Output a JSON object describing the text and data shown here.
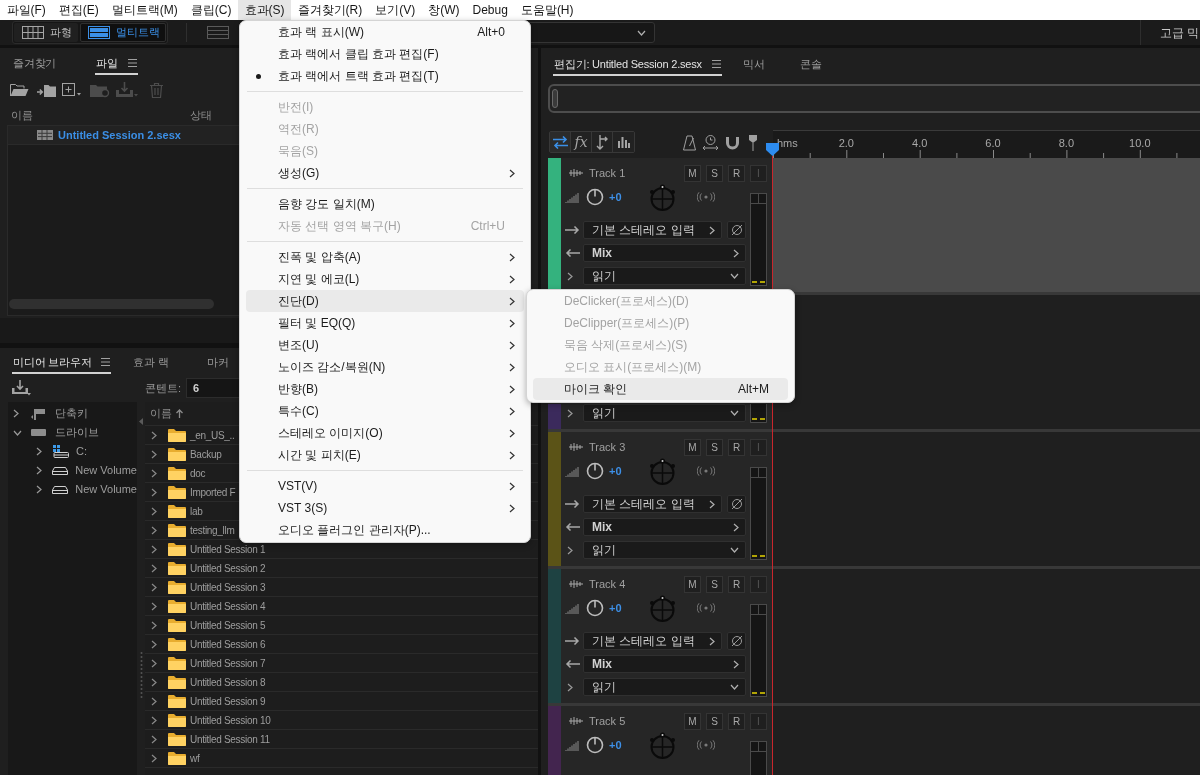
{
  "menu_bar": [
    {
      "label": "파일(F)",
      "selected": false
    },
    {
      "label": "편집(E)",
      "selected": false
    },
    {
      "label": "멀티트랙(M)",
      "selected": false
    },
    {
      "label": "클립(C)",
      "selected": false
    },
    {
      "label": "효과(S)",
      "selected": true
    },
    {
      "label": "즐겨찾기(R)",
      "selected": false
    },
    {
      "label": "보기(V)",
      "selected": false
    },
    {
      "label": "창(W)",
      "selected": false
    },
    {
      "label": "Debug",
      "selected": false
    },
    {
      "label": "도움말(H)",
      "selected": false
    }
  ],
  "toolbar": {
    "modes": [
      {
        "kind": "waveform",
        "label": "파형",
        "selected": false
      },
      {
        "kind": "multitrack",
        "label": "멀티트랙",
        "selected": true
      }
    ],
    "workspace": "고급 믹"
  },
  "files_panel": {
    "tabs": [
      {
        "label": "즐겨찾기",
        "selected": false
      },
      {
        "label": "파일",
        "selected": true
      }
    ],
    "columns": [
      "이름",
      "상태"
    ],
    "rows": [
      {
        "name": "Untitled Session 2.sesx"
      }
    ]
  },
  "media_browser": {
    "tabs": [
      {
        "label": "미디어 브라우저",
        "selected": true
      },
      {
        "label": "효과 랙",
        "selected": false
      },
      {
        "label": "마커",
        "selected": false
      }
    ],
    "content_label": "콘텐트:",
    "content_value": "6",
    "tree": [
      {
        "kind": "shortcuts",
        "label": "단축키",
        "expanded": false
      },
      {
        "kind": "drives",
        "label": "드라이브",
        "expanded": true,
        "children": [
          {
            "kind": "system-drive",
            "label": "C:",
            "expanded": false
          },
          {
            "kind": "drive",
            "label": "New Volume",
            "expanded": false
          },
          {
            "kind": "drive",
            "label": "New Volume",
            "expanded": false
          }
        ]
      }
    ],
    "list_header": "이름",
    "items": [
      {
        "kind": "folder",
        "name": "_en_US_.."
      },
      {
        "kind": "folder",
        "name": "Backup"
      },
      {
        "kind": "folder",
        "name": "doc"
      },
      {
        "kind": "folder",
        "name": "Imported F"
      },
      {
        "kind": "folder",
        "name": "lab"
      },
      {
        "kind": "folder",
        "name": "testing_llm"
      },
      {
        "kind": "folder",
        "name": "Untitled Session 1"
      },
      {
        "kind": "folder",
        "name": "Untitled Session 2"
      },
      {
        "kind": "folder",
        "name": "Untitled Session 3"
      },
      {
        "kind": "folder",
        "name": "Untitled Session 4"
      },
      {
        "kind": "folder",
        "name": "Untitled Session 5"
      },
      {
        "kind": "folder",
        "name": "Untitled Session 6"
      },
      {
        "kind": "folder",
        "name": "Untitled Session 7"
      },
      {
        "kind": "folder",
        "name": "Untitled Session 8"
      },
      {
        "kind": "folder",
        "name": "Untitled Session 9"
      },
      {
        "kind": "folder",
        "name": "Untitled Session 10"
      },
      {
        "kind": "folder",
        "name": "Untitled Session 11"
      },
      {
        "kind": "folder",
        "name": "wf"
      }
    ]
  },
  "editor": {
    "tabs": [
      {
        "label": "편집기: Untitled Session 2.sesx",
        "selected": true
      },
      {
        "label": "믹서",
        "selected": false
      },
      {
        "label": "콘솔",
        "selected": false
      }
    ],
    "view_buttons": [
      {
        "kind": "inputs-outputs",
        "selected": true
      },
      {
        "kind": "effects",
        "label": "fx",
        "selected": false
      },
      {
        "kind": "sends",
        "selected": false
      },
      {
        "kind": "eq",
        "selected": false
      }
    ],
    "ruler": [
      "hms",
      "2.0",
      "4.0",
      "6.0",
      "8.0",
      "10.0"
    ],
    "tracks": [
      {
        "name": "Track 1",
        "color": "#34b27e",
        "selected": true,
        "buttons": [
          {
            "label": "M",
            "disabled": false
          },
          {
            "label": "S",
            "disabled": false
          },
          {
            "label": "R",
            "disabled": false
          },
          {
            "label": "I",
            "disabled": true
          }
        ],
        "volume": "+0",
        "input": "기본 스테레오 입력",
        "output": "Mix",
        "automation": "읽기"
      },
      {
        "color": "#3b2a5c",
        "selected": false,
        "automation": "읽기"
      },
      {
        "name": "Track 3",
        "color": "#5b5317",
        "selected": false,
        "buttons": [
          {
            "label": "M",
            "disabled": false
          },
          {
            "label": "S",
            "disabled": false
          },
          {
            "label": "R",
            "disabled": false
          },
          {
            "label": "I",
            "disabled": true
          }
        ],
        "volume": "+0",
        "input": "기본 스테레오 입력",
        "output": "Mix",
        "automation": "읽기"
      },
      {
        "name": "Track 4",
        "color": "#1e4242",
        "selected": false,
        "buttons": [
          {
            "label": "M",
            "disabled": false
          },
          {
            "label": "S",
            "disabled": false
          },
          {
            "label": "R",
            "disabled": false
          },
          {
            "label": "I",
            "disabled": true
          }
        ],
        "volume": "+0",
        "input": "기본 스테레오 입력",
        "output": "Mix",
        "automation": "읽기"
      },
      {
        "name": "Track 5",
        "color": "#43254f",
        "selected": false,
        "buttons": [
          {
            "label": "M",
            "disabled": false
          },
          {
            "label": "S",
            "disabled": false
          },
          {
            "label": "R",
            "disabled": false
          },
          {
            "label": "I",
            "disabled": true
          }
        ],
        "volume": "+0"
      }
    ]
  },
  "effects_menu": {
    "items": [
      {
        "kind": "item",
        "label": "효과 랙 표시(W)",
        "shortcut": "Alt+0",
        "checked": false,
        "disabled": false,
        "submenu": false,
        "highlighted": false
      },
      {
        "kind": "item",
        "label": "효과 랙에서 클립 효과 편집(F)",
        "checked": false,
        "disabled": false,
        "submenu": false,
        "highlighted": false
      },
      {
        "kind": "item",
        "label": "효과 랙에서 트랙 효과 편집(T)",
        "checked": true,
        "disabled": false,
        "submenu": false,
        "highlighted": false
      },
      {
        "kind": "separator"
      },
      {
        "kind": "item",
        "label": "반전(I)",
        "checked": false,
        "disabled": true,
        "submenu": false,
        "highlighted": false
      },
      {
        "kind": "item",
        "label": "역전(R)",
        "checked": false,
        "disabled": true,
        "submenu": false,
        "highlighted": false
      },
      {
        "kind": "item",
        "label": "묵음(S)",
        "checked": false,
        "disabled": true,
        "submenu": false,
        "highlighted": false
      },
      {
        "kind": "item",
        "label": "생성(G)",
        "checked": false,
        "disabled": false,
        "submenu": true,
        "highlighted": false
      },
      {
        "kind": "separator"
      },
      {
        "kind": "item",
        "label": "음향 강도 일치(M)",
        "checked": false,
        "disabled": false,
        "submenu": false,
        "highlighted": false
      },
      {
        "kind": "item",
        "label": "자동 선택 영역 복구(H)",
        "shortcut": "Ctrl+U",
        "checked": false,
        "disabled": true,
        "submenu": false,
        "highlighted": false
      },
      {
        "kind": "separator"
      },
      {
        "kind": "item",
        "label": "진폭 및 압축(A)",
        "checked": false,
        "disabled": false,
        "submenu": true,
        "highlighted": false
      },
      {
        "kind": "item",
        "label": "지연 및 에코(L)",
        "checked": false,
        "disabled": false,
        "submenu": true,
        "highlighted": false
      },
      {
        "kind": "item",
        "label": "진단(D)",
        "checked": false,
        "disabled": false,
        "submenu": true,
        "highlighted": true
      },
      {
        "kind": "item",
        "label": "필터 및 EQ(Q)",
        "checked": false,
        "disabled": false,
        "submenu": true,
        "highlighted": false
      },
      {
        "kind": "item",
        "label": "변조(U)",
        "checked": false,
        "disabled": false,
        "submenu": true,
        "highlighted": false
      },
      {
        "kind": "item",
        "label": "노이즈 감소/복원(N)",
        "checked": false,
        "disabled": false,
        "submenu": true,
        "highlighted": false
      },
      {
        "kind": "item",
        "label": "반향(B)",
        "checked": false,
        "disabled": false,
        "submenu": true,
        "highlighted": false
      },
      {
        "kind": "item",
        "label": "특수(C)",
        "checked": false,
        "disabled": false,
        "submenu": true,
        "highlighted": false
      },
      {
        "kind": "item",
        "label": "스테레오 이미지(O)",
        "checked": false,
        "disabled": false,
        "submenu": true,
        "highlighted": false
      },
      {
        "kind": "item",
        "label": "시간 및 피치(E)",
        "checked": false,
        "disabled": false,
        "submenu": true,
        "highlighted": false
      },
      {
        "kind": "separator"
      },
      {
        "kind": "item",
        "label": "VST(V)",
        "checked": false,
        "disabled": false,
        "submenu": true,
        "highlighted": false
      },
      {
        "kind": "item",
        "label": "VST 3(S)",
        "checked": false,
        "disabled": false,
        "submenu": true,
        "highlighted": false
      },
      {
        "kind": "item",
        "label": "오디오 플러그인 관리자(P)...",
        "checked": false,
        "disabled": false,
        "submenu": false,
        "highlighted": false
      }
    ]
  },
  "diagnostics_submenu": {
    "items": [
      {
        "kind": "item",
        "label": "DeClicker(프로세스)(D)",
        "checked": false,
        "disabled": true,
        "submenu": false,
        "highlighted": false
      },
      {
        "kind": "item",
        "label": "DeClipper(프로세스)(P)",
        "checked": false,
        "disabled": true,
        "submenu": false,
        "highlighted": false
      },
      {
        "kind": "item",
        "label": "묵음 삭제(프로세스)(S)",
        "checked": false,
        "disabled": true,
        "submenu": false,
        "highlighted": false
      },
      {
        "kind": "item",
        "label": "오디오 표시(프로세스)(M)",
        "checked": false,
        "disabled": true,
        "submenu": false,
        "highlighted": false
      },
      {
        "kind": "item",
        "label": "마이크 확인",
        "shortcut": "Alt+M",
        "checked": false,
        "disabled": false,
        "submenu": false,
        "highlighted": true
      }
    ]
  }
}
